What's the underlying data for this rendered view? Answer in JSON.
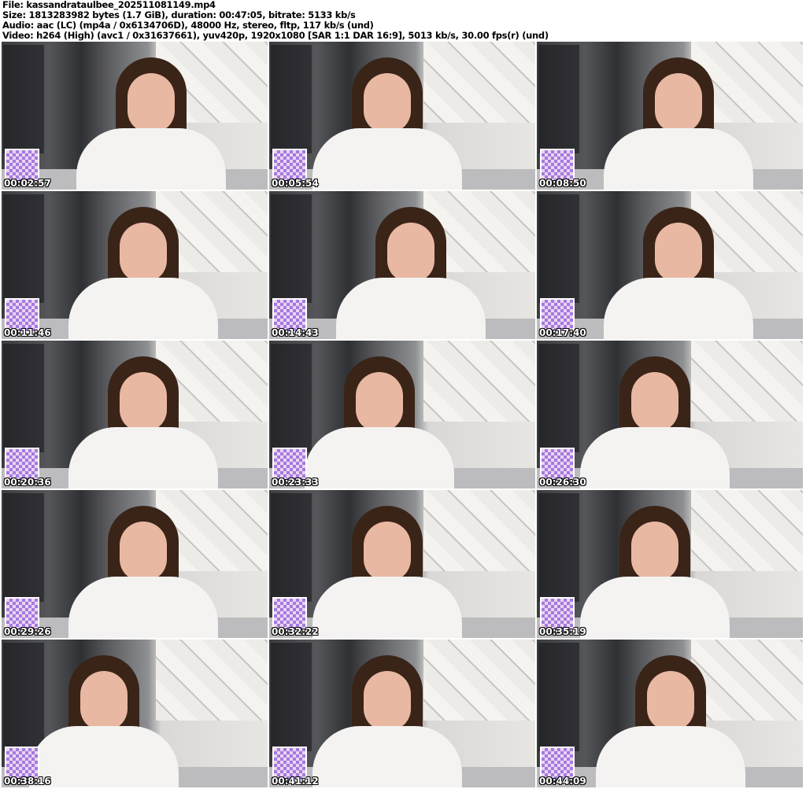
{
  "header": {
    "file": "File: kassandrataulbee_202511081149.mp4",
    "size": "Size: 1813283982 bytes (1.7 GiB), duration: 00:47:05, bitrate: 5133 kb/s",
    "audio": "Audio: aac (LC) (mp4a / 0x6134706D), 48000 Hz, stereo, fltp, 117 kb/s (und)",
    "video": "Video: h264 (High) (avc1 / 0x31637661), yuv420p, 1920x1080 [SAR 1:1 DAR 16:9], 5013 kb/s, 30.00 fps(r) (und)"
  },
  "thumbnails": [
    {
      "timestamp": "00:02:57"
    },
    {
      "timestamp": "00:05:54"
    },
    {
      "timestamp": "00:08:50"
    },
    {
      "timestamp": "00:11:46"
    },
    {
      "timestamp": "00:14:43"
    },
    {
      "timestamp": "00:17:40"
    },
    {
      "timestamp": "00:20:36"
    },
    {
      "timestamp": "00:23:33"
    },
    {
      "timestamp": "00:26:30"
    },
    {
      "timestamp": "00:29:26"
    },
    {
      "timestamp": "00:32:22"
    },
    {
      "timestamp": "00:35:19"
    },
    {
      "timestamp": "00:38:16"
    },
    {
      "timestamp": "00:41:12"
    },
    {
      "timestamp": "00:44:09"
    }
  ]
}
